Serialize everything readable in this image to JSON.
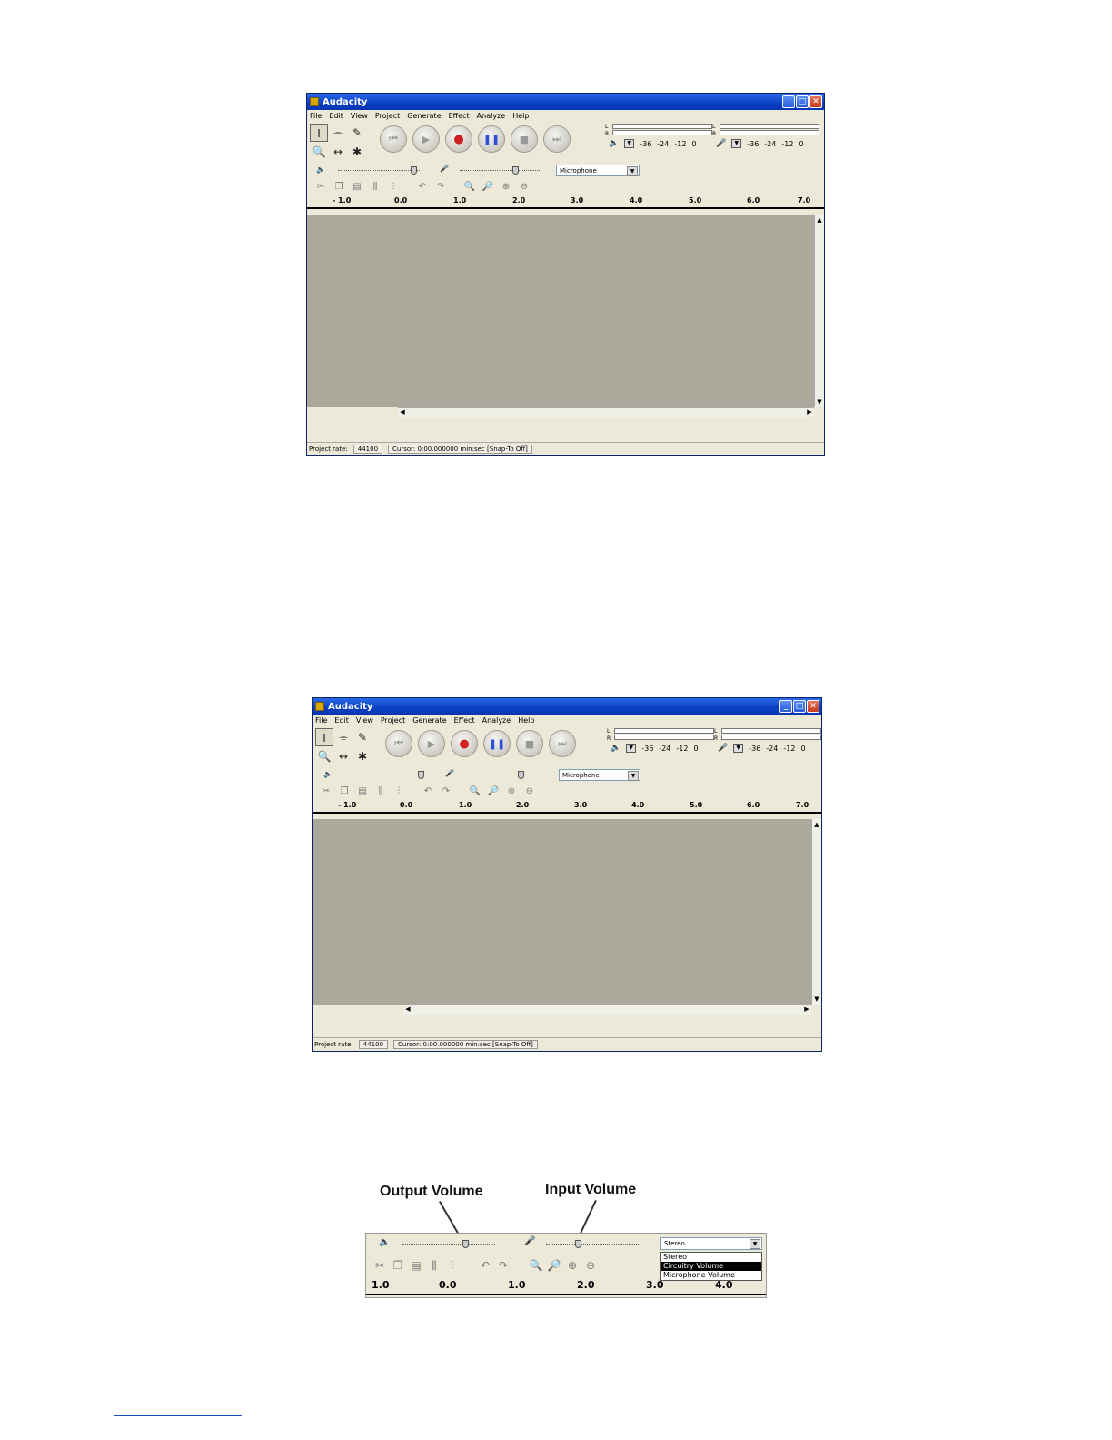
{
  "window": {
    "title": "Audacity",
    "menu": [
      "File",
      "Edit",
      "View",
      "Project",
      "Generate",
      "Effect",
      "Analyze",
      "Help"
    ],
    "tools": [
      "I",
      "⌯",
      "✎",
      "🔍",
      "↔",
      "✱"
    ],
    "transport": [
      "⏮",
      "▶",
      "●",
      "❚❚",
      "■",
      "⏭"
    ],
    "meter_labels": {
      "left": "L",
      "right": "R"
    },
    "meter_scale": [
      "-36",
      "-24",
      "-12",
      "0"
    ],
    "input_source": "Microphone",
    "ruler": [
      "- 1.0",
      "0.0",
      "1.0",
      "2.0",
      "3.0",
      "4.0",
      "5.0",
      "6.0",
      "7.0"
    ],
    "status": {
      "project_rate_label": "Project rate:",
      "project_rate": "44100",
      "cursor": "Cursor: 0:00.000000 min:sec",
      "snap": "[Snap-To Off]"
    }
  },
  "window2": {
    "status": {
      "project_rate_label": "Project rate:",
      "project_rate": "44100",
      "cursor": "Cursor: 0:00.000000 min:sec",
      "snap": "[Snap-To Off]"
    }
  },
  "detail": {
    "output_label": "Output Volume",
    "input_label": "Input Volume",
    "select_value": "Stereo",
    "options": [
      "Stereo",
      "Circuitry Volume",
      "Microphone Volume"
    ],
    "highlighted_option": 1,
    "ruler": [
      "1.0",
      "0.0",
      "1.0",
      "2.0",
      "3.0",
      "4.0"
    ]
  }
}
